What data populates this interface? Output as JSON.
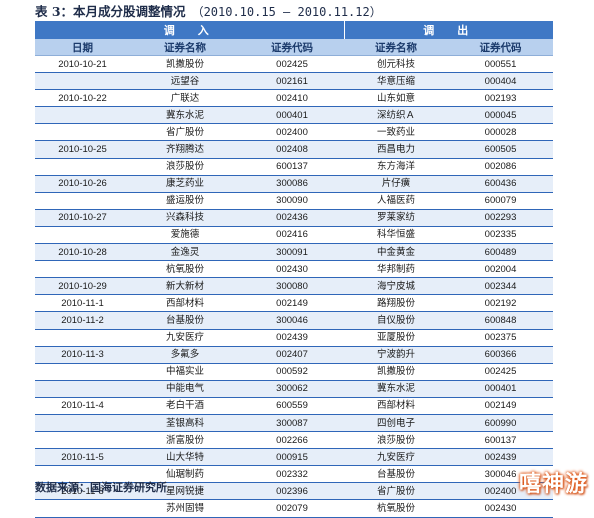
{
  "title": {
    "label": "表 3：本月成分股调整情况",
    "date_range": "（2010.10.15 – 2010.11.12）"
  },
  "headers": {
    "group_in": "调　入",
    "group_out": "调　出",
    "date": "日期",
    "name_in": "证券名称",
    "code_in": "证券代码",
    "name_out": "证券名称",
    "code_out": "证券代码"
  },
  "rows": [
    {
      "date": "2010-10-21",
      "name_in": "凯撒股份",
      "code_in": "002425",
      "name_out": "创元科技",
      "code_out": "000551"
    },
    {
      "date": "",
      "name_in": "远望谷",
      "code_in": "002161",
      "name_out": "华意压缩",
      "code_out": "000404"
    },
    {
      "date": "2010-10-22",
      "name_in": "广联达",
      "code_in": "002410",
      "name_out": "山东如意",
      "code_out": "002193"
    },
    {
      "date": "",
      "name_in": "冀东水泥",
      "code_in": "000401",
      "name_out": "深纺织Ａ",
      "code_out": "000045"
    },
    {
      "date": "",
      "name_in": "省广股份",
      "code_in": "002400",
      "name_out": "一致药业",
      "code_out": "000028"
    },
    {
      "date": "2010-10-25",
      "name_in": "齐翔腾达",
      "code_in": "002408",
      "name_out": "西昌电力",
      "code_out": "600505"
    },
    {
      "date": "",
      "name_in": "浪莎股份",
      "code_in": "600137",
      "name_out": "东方海洋",
      "code_out": "002086"
    },
    {
      "date": "2010-10-26",
      "name_in": "康芝药业",
      "code_in": "300086",
      "name_out": "片仔癀",
      "code_out": "600436"
    },
    {
      "date": "",
      "name_in": "盛运股份",
      "code_in": "300090",
      "name_out": "人福医药",
      "code_out": "600079"
    },
    {
      "date": "2010-10-27",
      "name_in": "兴森科技",
      "code_in": "002436",
      "name_out": "罗莱家纺",
      "code_out": "002293"
    },
    {
      "date": "",
      "name_in": "爱施德",
      "code_in": "002416",
      "name_out": "科华恒盛",
      "code_out": "002335"
    },
    {
      "date": "2010-10-28",
      "name_in": "金逸灵",
      "code_in": "300091",
      "name_out": "中金黄金",
      "code_out": "600489"
    },
    {
      "date": "",
      "name_in": "杭氧股份",
      "code_in": "002430",
      "name_out": "华邦制药",
      "code_out": "002004"
    },
    {
      "date": "2010-10-29",
      "name_in": "新大新材",
      "code_in": "300080",
      "name_out": "海宁皮城",
      "code_out": "002344"
    },
    {
      "date": "2010-11-1",
      "name_in": "西部材料",
      "code_in": "002149",
      "name_out": "路翔股份",
      "code_out": "002192"
    },
    {
      "date": "2010-11-2",
      "name_in": "台基股份",
      "code_in": "300046",
      "name_out": "自仪股份",
      "code_out": "600848"
    },
    {
      "date": "",
      "name_in": "九安医疗",
      "code_in": "002439",
      "name_out": "亚厦股份",
      "code_out": "002375"
    },
    {
      "date": "2010-11-3",
      "name_in": "多氟多",
      "code_in": "002407",
      "name_out": "宁波韵升",
      "code_out": "600366"
    },
    {
      "date": "",
      "name_in": "中福实业",
      "code_in": "000592",
      "name_out": "凯撒股份",
      "code_out": "002425"
    },
    {
      "date": "",
      "name_in": "中能电气",
      "code_in": "300062",
      "name_out": "冀东水泥",
      "code_out": "000401"
    },
    {
      "date": "2010-11-4",
      "name_in": "老白干酒",
      "code_in": "600559",
      "name_out": "西部材料",
      "code_out": "002149"
    },
    {
      "date": "",
      "name_in": "荃银高科",
      "code_in": "300087",
      "name_out": "四创电子",
      "code_out": "600990"
    },
    {
      "date": "",
      "name_in": "浙富股份",
      "code_in": "002266",
      "name_out": "浪莎股份",
      "code_out": "600137"
    },
    {
      "date": "2010-11-5",
      "name_in": "山大华特",
      "code_in": "000915",
      "name_out": "九安医疗",
      "code_out": "002439"
    },
    {
      "date": "",
      "name_in": "仙琚制药",
      "code_in": "002332",
      "name_out": "台基股份",
      "code_out": "300046"
    },
    {
      "date": "2010-11-8",
      "name_in": "星网锐捷",
      "code_in": "002396",
      "name_out": "省广股份",
      "code_out": "002400"
    },
    {
      "date": "",
      "name_in": "苏州固锝",
      "code_in": "002079",
      "name_out": "杭氧股份",
      "code_out": "002430"
    }
  ],
  "source": "数据来源：国海证券研究所",
  "watermark": "嘻神游"
}
